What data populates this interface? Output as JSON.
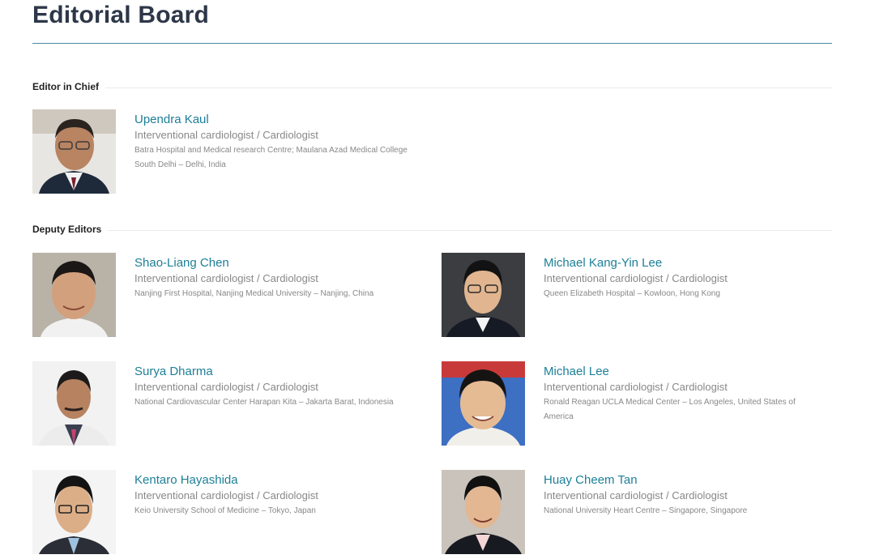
{
  "page": {
    "title": "Editorial Board"
  },
  "sections": {
    "chief": {
      "label": "Editor in Chief"
    },
    "deputy": {
      "label": "Deputy Editors"
    }
  },
  "editors": [
    {
      "name": "Upendra Kaul",
      "role": "Interventional cardiologist / Cardiologist",
      "affiliation": "Batra Hospital and Medical research Centre; Maulana Azad Medical College",
      "location": "South Delhi – Delhi, India"
    },
    {
      "name": "Shao-Liang Chen",
      "role": "Interventional cardiologist / Cardiologist",
      "affiliation": "Nanjing First Hospital, Nanjing Medical University – Nanjing, China",
      "location": ""
    },
    {
      "name": "Michael Kang-Yin Lee",
      "role": "Interventional cardiologist / Cardiologist",
      "affiliation": "Queen Elizabeth Hospital – Kowloon, Hong Kong",
      "location": ""
    },
    {
      "name": "Surya Dharma",
      "role": "Interventional cardiologist / Cardiologist",
      "affiliation": "National Cardiovascular Center Harapan Kita – Jakarta Barat, Indonesia",
      "location": ""
    },
    {
      "name": "Michael Lee",
      "role": "Interventional cardiologist / Cardiologist",
      "affiliation": "Ronald Reagan UCLA Medical Center – Los Angeles, United States of",
      "location": "America"
    },
    {
      "name": "Kentaro Hayashida",
      "role": "Interventional cardiologist / Cardiologist",
      "affiliation": "Keio University School of Medicine – Tokyo, Japan",
      "location": ""
    },
    {
      "name": "Huay Cheem Tan",
      "role": "Interventional cardiologist / Cardiologist",
      "affiliation": "National University Heart Centre – Singapore, Singapore",
      "location": ""
    }
  ],
  "colors": {
    "accent_link": "#1c7f97",
    "title": "#2d3748",
    "rule": "#4a8aa6",
    "muted_text": "#888888"
  },
  "icons": [
    "portrait-photo"
  ]
}
